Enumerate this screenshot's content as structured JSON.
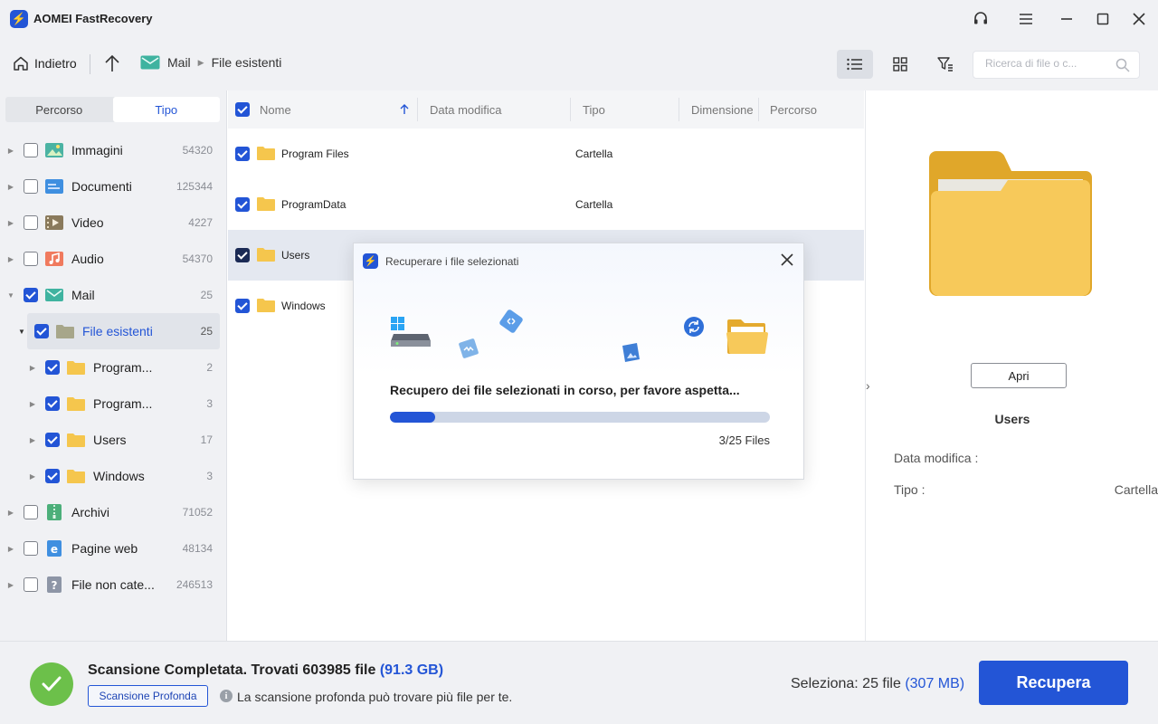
{
  "app": {
    "title": "AOMEI FastRecovery"
  },
  "toolbar": {
    "back_label": "Indietro",
    "breadcrumb": [
      "Mail",
      "File esistenti"
    ],
    "search_placeholder": "Ricerca di file o c..."
  },
  "sidebar": {
    "tabs": [
      "Percorso",
      "Tipo"
    ],
    "active_tab": "Tipo",
    "items": [
      {
        "label": "Immagini",
        "count": "54320",
        "checked": false,
        "icon": "image-icon"
      },
      {
        "label": "Documenti",
        "count": "125344",
        "checked": false,
        "icon": "document-icon"
      },
      {
        "label": "Video",
        "count": "4227",
        "checked": false,
        "icon": "video-icon"
      },
      {
        "label": "Audio",
        "count": "54370",
        "checked": false,
        "icon": "audio-icon"
      },
      {
        "label": "Mail",
        "count": "25",
        "checked": true,
        "icon": "mail-icon"
      },
      {
        "label": "File esistenti",
        "count": "25",
        "checked": true,
        "icon": "folder-icon"
      },
      {
        "label": "Program...",
        "count": "2",
        "checked": true,
        "icon": "folder-icon"
      },
      {
        "label": "Program...",
        "count": "3",
        "checked": true,
        "icon": "folder-icon"
      },
      {
        "label": "Users",
        "count": "17",
        "checked": true,
        "icon": "folder-icon"
      },
      {
        "label": "Windows",
        "count": "3",
        "checked": true,
        "icon": "folder-icon"
      },
      {
        "label": "Archivi",
        "count": "71052",
        "checked": false,
        "icon": "archive-icon"
      },
      {
        "label": "Pagine web",
        "count": "48134",
        "checked": false,
        "icon": "web-icon"
      },
      {
        "label": "File non cate...",
        "count": "246513",
        "checked": false,
        "icon": "unknown-file-icon"
      }
    ]
  },
  "list": {
    "columns": [
      "Nome",
      "Data modifica",
      "Tipo",
      "Dimensione",
      "Percorso"
    ],
    "rows": [
      {
        "name": "Program Files",
        "type": "Cartella"
      },
      {
        "name": "ProgramData",
        "type": "Cartella"
      },
      {
        "name": "Users",
        "type": ""
      },
      {
        "name": "Windows",
        "type": ""
      }
    ]
  },
  "preview": {
    "open_label": "Apri",
    "name": "Users",
    "modified_label": "Data modifica :",
    "modified_value": "",
    "type_label": "Tipo :",
    "type_value": "Cartella"
  },
  "modal": {
    "title": "Recuperare i file selezionati",
    "message": "Recupero dei file selezionati in corso, per favore aspetta...",
    "progress_fraction": 0.12,
    "count_text": "3/25 Files"
  },
  "bottom": {
    "scan_text": "Scansione Completata. Trovati 603985 file",
    "scan_size": "(91.3 GB)",
    "deep_scan_label": "Scansione Profonda",
    "deep_hint": "La scansione profonda può trovare più file per te.",
    "select_text": "Seleziona: 25 file",
    "select_size": "(307 MB)",
    "recover_label": "Recupera"
  },
  "colors": {
    "accent": "#2355d6",
    "success": "#6cc04a",
    "folder": "#f5c64d"
  }
}
